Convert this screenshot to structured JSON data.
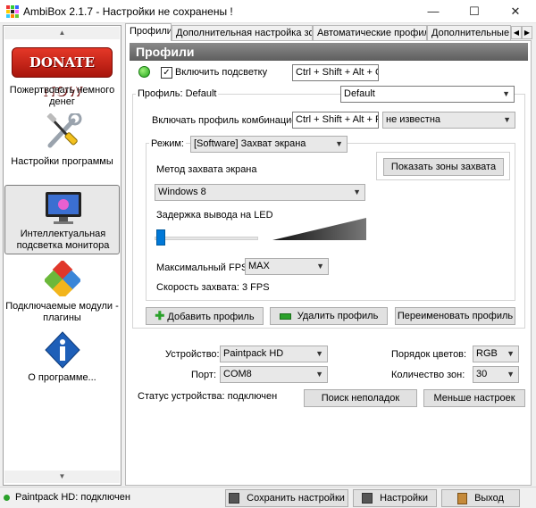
{
  "window": {
    "title": "AmbiBox 2.1.7  - Настройки не сохранены !",
    "minimize": "—",
    "maximize": "☐",
    "close": "✕"
  },
  "sidebar": {
    "donate_logo": "DONATE NOW",
    "items": [
      {
        "label": "Пожертвовать немного денег",
        "icon": "donate-icon"
      },
      {
        "label": "Настройки программы",
        "icon": "tools-icon"
      },
      {
        "label": "Интеллектуальная подсветка монитора",
        "icon": "monitor-icon"
      },
      {
        "label": "Подключаемые модули - плагины",
        "icon": "puzzle-icon"
      },
      {
        "label": "О программе...",
        "icon": "info-icon"
      }
    ]
  },
  "tabs": [
    "Профили",
    "Дополнительная настройка зон",
    "Автоматические профили",
    "Дополнительные н"
  ],
  "panel": {
    "header": "Профили",
    "enable_backlight": "Включить подсветку",
    "enable_backlight_checked": true,
    "backlight_hotkey": "Ctrl + Shift + Alt + O",
    "profile_group_title": "Профиль: Default",
    "profile_select": "Default",
    "enable_profile_label": "Включать профиль комбинацией:",
    "profile_hotkey": "Ctrl + Shift + Alt + P",
    "unknown_select": "не известна",
    "mode_label": "Режим:",
    "mode_select": "[Software] Захват экрана",
    "capture_method_label": "Метод захвата экрана",
    "show_zones_button": "Показать зоны захвата",
    "capture_method_select": "Windows 8",
    "led_delay_label": "Задержка вывода на LED",
    "led_delay_value": 0.02,
    "max_fps_label": "Максимальный FPS",
    "max_fps_select": "MAX",
    "capture_speed": "Скорость захвата: 3 FPS",
    "add_profile": "Добавить профиль",
    "delete_profile": "Удалить профиль",
    "rename_profile": "Переименовать профиль",
    "device_label": "Устройство:",
    "device_select": "Paintpack HD",
    "color_order_label": "Порядок цветов:",
    "color_order_select": "RGB",
    "port_label": "Порт:",
    "port_select": "COM8",
    "zones_label": "Количество зон:",
    "zones_select": "30",
    "device_status": "Статус устройства: подключен",
    "troubleshoot_button": "Поиск неполадок",
    "less_settings_button": "Меньше настроек"
  },
  "statusbar": {
    "status_text": "Paintpack HD: подключен",
    "save_button": "Сохранить настройки",
    "settings_button": "Настройки",
    "exit_button": "Выход"
  }
}
